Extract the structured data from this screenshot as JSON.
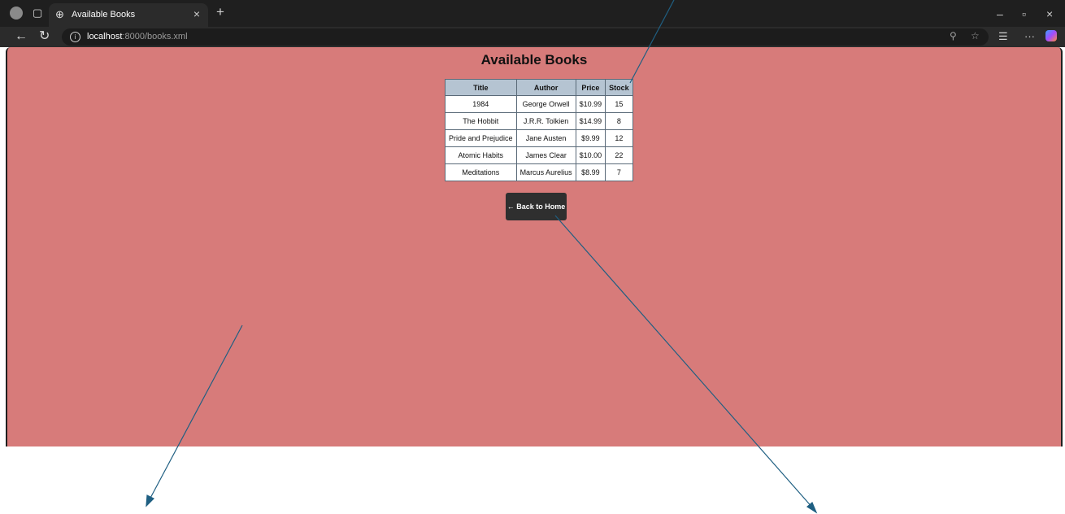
{
  "browser": {
    "tab_title": "Available Books",
    "tab_close": "×",
    "new_tab": "+",
    "url_host": "localhost",
    "url_path": ":8000/books.xml",
    "icons": [
      "profile-icon",
      "tab-actions-icon",
      "globe-icon",
      "back-arrow-icon",
      "reload-icon",
      "info-icon",
      "zoom-icon",
      "favorite-star-icon",
      "favorites-icon",
      "more-icon",
      "copilot-icon"
    ]
  },
  "window_controls": {
    "minimize": "–",
    "restore": "▫",
    "close": "×"
  },
  "page": {
    "title": "Available Books",
    "background_color": "#d77b7a",
    "table": {
      "headers": [
        "Title",
        "Author",
        "Price",
        "Stock"
      ],
      "rows": [
        [
          "1984",
          "George Orwell",
          "$10.99",
          "15"
        ],
        [
          "The Hobbit",
          "J.R.R. Tolkien",
          "$14.99",
          "8"
        ],
        [
          "Pride and Prejudice",
          "Jane Austen",
          "$9.99",
          "12"
        ],
        [
          "Atomic Habits",
          "James Clear",
          "$10.00",
          "22"
        ],
        [
          "Meditations",
          "Marcus Aurelius",
          "$8.99",
          "7"
        ]
      ]
    },
    "back_button_label": "← Back to Home"
  }
}
